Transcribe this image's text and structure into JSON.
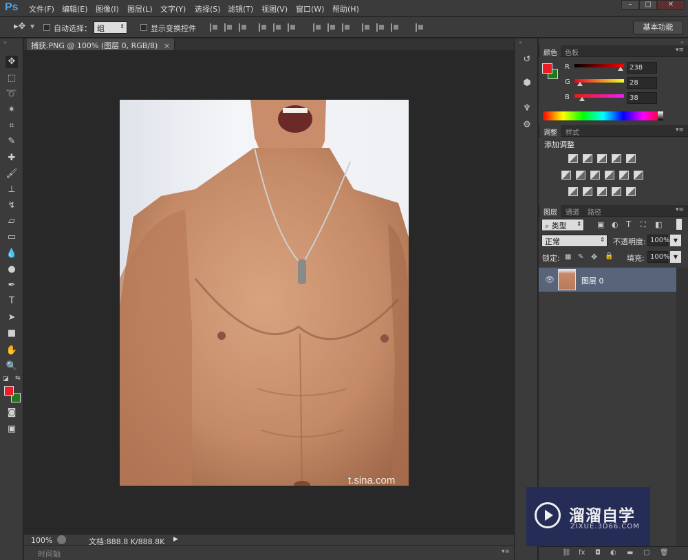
{
  "app": {
    "logo": "Ps"
  },
  "menu": [
    "文件(F)",
    "编辑(E)",
    "图像(I)",
    "图层(L)",
    "文字(Y)",
    "选择(S)",
    "滤镜(T)",
    "视图(V)",
    "窗口(W)",
    "帮助(H)"
  ],
  "window_controls": {
    "minimize": "–",
    "maximize": "□",
    "close": "✕"
  },
  "options_bar": {
    "auto_select_label": "自动选择：",
    "auto_select_value": "组",
    "show_transform_label": "显示变换控件",
    "workspace": "基本功能"
  },
  "document": {
    "tab_title": "捕获.PNG @ 100% (图层 0, RGB/8)",
    "tab_close": "×",
    "watermark_text": "t.sina.com"
  },
  "status": {
    "zoom": "100%",
    "doc_info": "文档:888.8 K/888.8K",
    "timeline": "时间轴"
  },
  "color_panel": {
    "tabs": [
      "颜色",
      "色板"
    ],
    "fg": "#ee1c26",
    "bg": "#1b7a1b",
    "channels": [
      {
        "label": "R",
        "value": "238",
        "fraction": 0.93
      },
      {
        "label": "G",
        "value": "28",
        "fraction": 0.11
      },
      {
        "label": "B",
        "value": "38",
        "fraction": 0.15
      }
    ]
  },
  "adjustments_panel": {
    "tabs": [
      "调整",
      "样式"
    ],
    "title": "添加调整"
  },
  "layers_panel": {
    "tabs": [
      "图层",
      "通道",
      "路径"
    ],
    "filter": "类型",
    "blend_mode": "正常",
    "opacity_label": "不透明度:",
    "opacity_value": "100%",
    "lock_label": "锁定:",
    "fill_label": "填充:",
    "fill_value": "100%",
    "layer_name": "图层 0"
  },
  "logo_watermark": {
    "main": "溜溜自学",
    "sub": "ZIXUE.3D66.COM"
  },
  "colors": {
    "accent": "#4da3e8",
    "layer_selected": "#58647a",
    "logo_bg": "#242d5a"
  }
}
